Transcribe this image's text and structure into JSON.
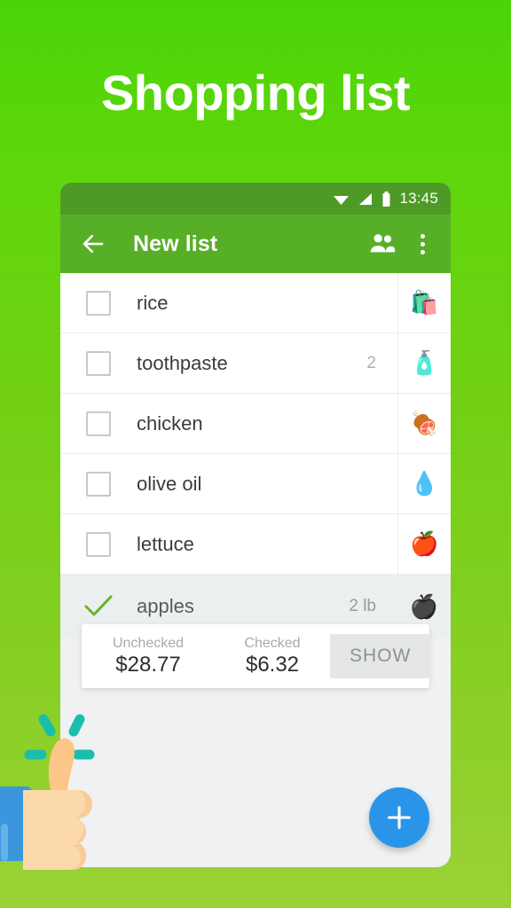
{
  "hero": {
    "title": "Shopping list"
  },
  "colors": {
    "background_top": "#4ad509",
    "background_bottom": "#9bd136",
    "status_bar": "#4e9a26",
    "app_bar": "#57af27",
    "fab": "#2a95e8",
    "check_green": "#61b62c",
    "thumb_skin": "#fcd29b",
    "thumb_sleeve": "#3c96dd",
    "spark_teal": "#19bfad"
  },
  "status_bar": {
    "wifi_icon": "wifi-icon",
    "signal_icon": "signal-icon",
    "battery_icon": "battery-icon",
    "time": "13:45"
  },
  "app_bar": {
    "back_icon": "back-arrow-icon",
    "title": "New list",
    "people_icon": "people-icon",
    "overflow_icon": "overflow-menu-icon"
  },
  "list": {
    "items": [
      {
        "label": "rice",
        "quantity": "",
        "emoji": "🛍️",
        "emoji_name": "shopping-bag-icon",
        "checked": false
      },
      {
        "label": "toothpaste",
        "quantity": "2",
        "emoji": "🧴",
        "emoji_name": "lotion-bottle-icon",
        "checked": false
      },
      {
        "label": "chicken",
        "quantity": "",
        "emoji": "🍖",
        "emoji_name": "meat-on-bone-icon",
        "checked": false
      },
      {
        "label": "olive oil",
        "quantity": "",
        "emoji": "💧",
        "emoji_name": "droplet-icon",
        "checked": false
      },
      {
        "label": "lettuce",
        "quantity": "",
        "emoji": "🍎",
        "emoji_name": "apple-icon",
        "checked": false
      },
      {
        "label": "apples",
        "quantity": "2 lb",
        "emoji": "🍎",
        "emoji_name": "apple-icon",
        "checked": true
      }
    ]
  },
  "summary": {
    "unchecked_caption": "Unchecked",
    "unchecked_value": "$28.77",
    "checked_caption": "Checked",
    "checked_value": "$6.32",
    "show_label": "SHOW"
  },
  "fab": {
    "icon": "plus-icon"
  },
  "illustration": {
    "name": "thumbs-up-illustration"
  }
}
